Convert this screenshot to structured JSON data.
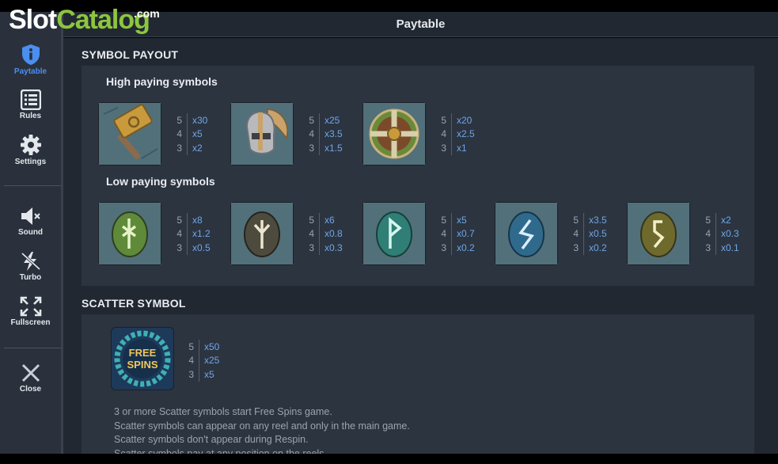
{
  "watermark": {
    "part1": "Slot",
    "part2": "Catalog",
    "suffix": ".com"
  },
  "header": {
    "title": "Paytable"
  },
  "sidebar": {
    "items": [
      {
        "label": "Paytable",
        "icon": "info-shield-icon"
      },
      {
        "label": "Rules",
        "icon": "list-icon"
      },
      {
        "label": "Settings",
        "icon": "gear-icon"
      },
      {
        "label": "Sound",
        "icon": "speaker-muted-icon"
      },
      {
        "label": "Turbo",
        "icon": "lightning-off-icon"
      },
      {
        "label": "Fullscreen",
        "icon": "fullscreen-icon"
      },
      {
        "label": "Close",
        "icon": "close-icon"
      }
    ],
    "active_color": "#4a8ef0"
  },
  "symbol_payout": {
    "title": "SYMBOL PAYOUT",
    "high_title": "High paying symbols",
    "high": [
      {
        "name": "hammer",
        "pays": [
          {
            "count": "5",
            "mult": "x30"
          },
          {
            "count": "4",
            "mult": "x5"
          },
          {
            "count": "3",
            "mult": "x2"
          }
        ]
      },
      {
        "name": "winged-helmet",
        "pays": [
          {
            "count": "5",
            "mult": "x25"
          },
          {
            "count": "4",
            "mult": "x3.5"
          },
          {
            "count": "3",
            "mult": "x1.5"
          }
        ]
      },
      {
        "name": "shield",
        "pays": [
          {
            "count": "5",
            "mult": "x20"
          },
          {
            "count": "4",
            "mult": "x2.5"
          },
          {
            "count": "3",
            "mult": "x1"
          }
        ]
      }
    ],
    "low_title": "Low paying symbols",
    "low": [
      {
        "name": "green-rune",
        "color": "#5f8a3a",
        "pays": [
          {
            "count": "5",
            "mult": "x8"
          },
          {
            "count": "4",
            "mult": "x1.2"
          },
          {
            "count": "3",
            "mult": "x0.5"
          }
        ]
      },
      {
        "name": "dark-rune",
        "color": "#4d4a3e",
        "pays": [
          {
            "count": "5",
            "mult": "x6"
          },
          {
            "count": "4",
            "mult": "x0.8"
          },
          {
            "count": "3",
            "mult": "x0.3"
          }
        ]
      },
      {
        "name": "teal-rune",
        "color": "#2f7f76",
        "pays": [
          {
            "count": "5",
            "mult": "x5"
          },
          {
            "count": "4",
            "mult": "x0.7"
          },
          {
            "count": "3",
            "mult": "x0.2"
          }
        ]
      },
      {
        "name": "blue-rune",
        "color": "#2f6a8c",
        "pays": [
          {
            "count": "5",
            "mult": "x3.5"
          },
          {
            "count": "4",
            "mult": "x0.5"
          },
          {
            "count": "3",
            "mult": "x0.2"
          }
        ]
      },
      {
        "name": "olive-rune",
        "color": "#6e6a2e",
        "pays": [
          {
            "count": "5",
            "mult": "x2"
          },
          {
            "count": "4",
            "mult": "x0.3"
          },
          {
            "count": "3",
            "mult": "x0.1"
          }
        ]
      }
    ]
  },
  "scatter": {
    "title": "SCATTER SYMBOL",
    "symbol_text_1": "FREE",
    "symbol_text_2": "SPINS",
    "pays": [
      {
        "count": "5",
        "mult": "x50"
      },
      {
        "count": "4",
        "mult": "x25"
      },
      {
        "count": "3",
        "mult": "x5"
      }
    ],
    "rules": [
      "3 or more Scatter symbols start Free Spins game.",
      "Scatter symbols can appear on any reel and only in the main game.",
      "Scatter symbols don't appear during Respin.",
      "Scatter symbols pay at any position on the reels."
    ]
  }
}
